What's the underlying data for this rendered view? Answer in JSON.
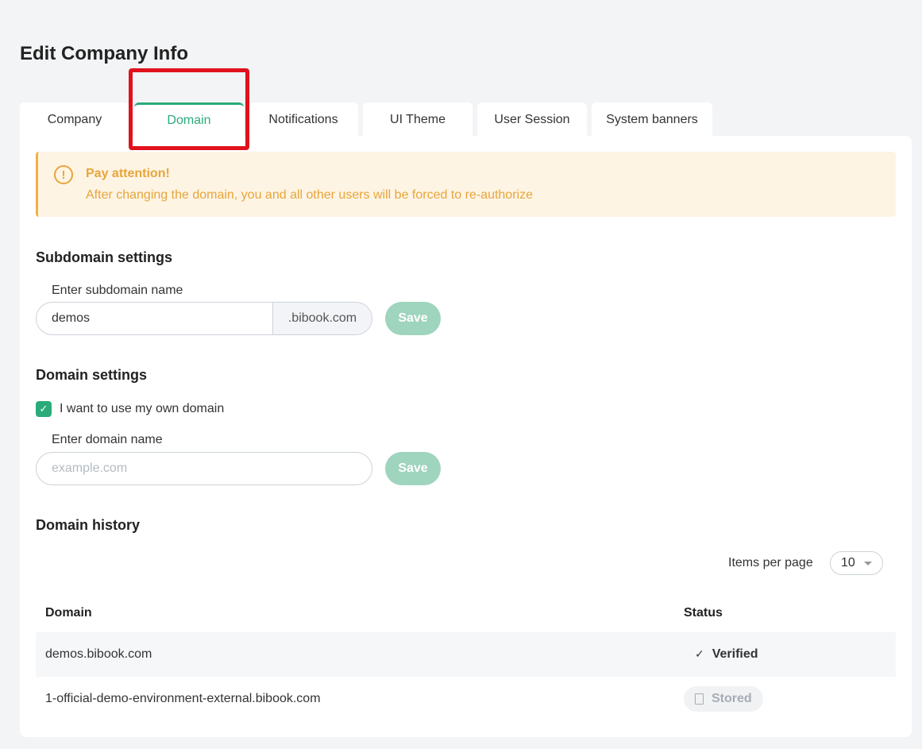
{
  "page": {
    "title": "Edit Company Info"
  },
  "tabs": [
    {
      "label": "Company",
      "active": false
    },
    {
      "label": "Domain",
      "active": true
    },
    {
      "label": "Notifications",
      "active": false
    },
    {
      "label": "UI Theme",
      "active": false
    },
    {
      "label": "User Session",
      "active": false
    },
    {
      "label": "System banners",
      "active": false
    }
  ],
  "alert": {
    "icon": "exclamation-circle-icon",
    "title": "Pay attention!",
    "text": "After changing the domain, you and all other users will be forced to re-authorize"
  },
  "subdomain": {
    "section_title": "Subdomain settings",
    "label": "Enter subdomain name",
    "value": "demos",
    "suffix": ".bibook.com",
    "save_label": "Save"
  },
  "domain": {
    "section_title": "Domain settings",
    "checkbox_label": "I want to use my own domain",
    "checkbox_checked": true,
    "label": "Enter domain name",
    "placeholder": "example.com",
    "value": "",
    "save_label": "Save"
  },
  "history": {
    "section_title": "Domain history",
    "items_per_page_label": "Items per page",
    "items_per_page_value": "10",
    "columns": [
      "Domain",
      "Status"
    ],
    "rows": [
      {
        "domain": "demos.bibook.com",
        "status": "Verified",
        "status_icon": "check-icon"
      },
      {
        "domain": "1-official-demo-environment-external.bibook.com",
        "status": "Stored",
        "status_icon": "document-icon"
      }
    ]
  },
  "colors": {
    "accent": "#2bab7a",
    "save_button": "#9fd4be",
    "warning": "#e8a53a",
    "warning_bg": "#fef4e4",
    "highlight": "#e0121c"
  }
}
